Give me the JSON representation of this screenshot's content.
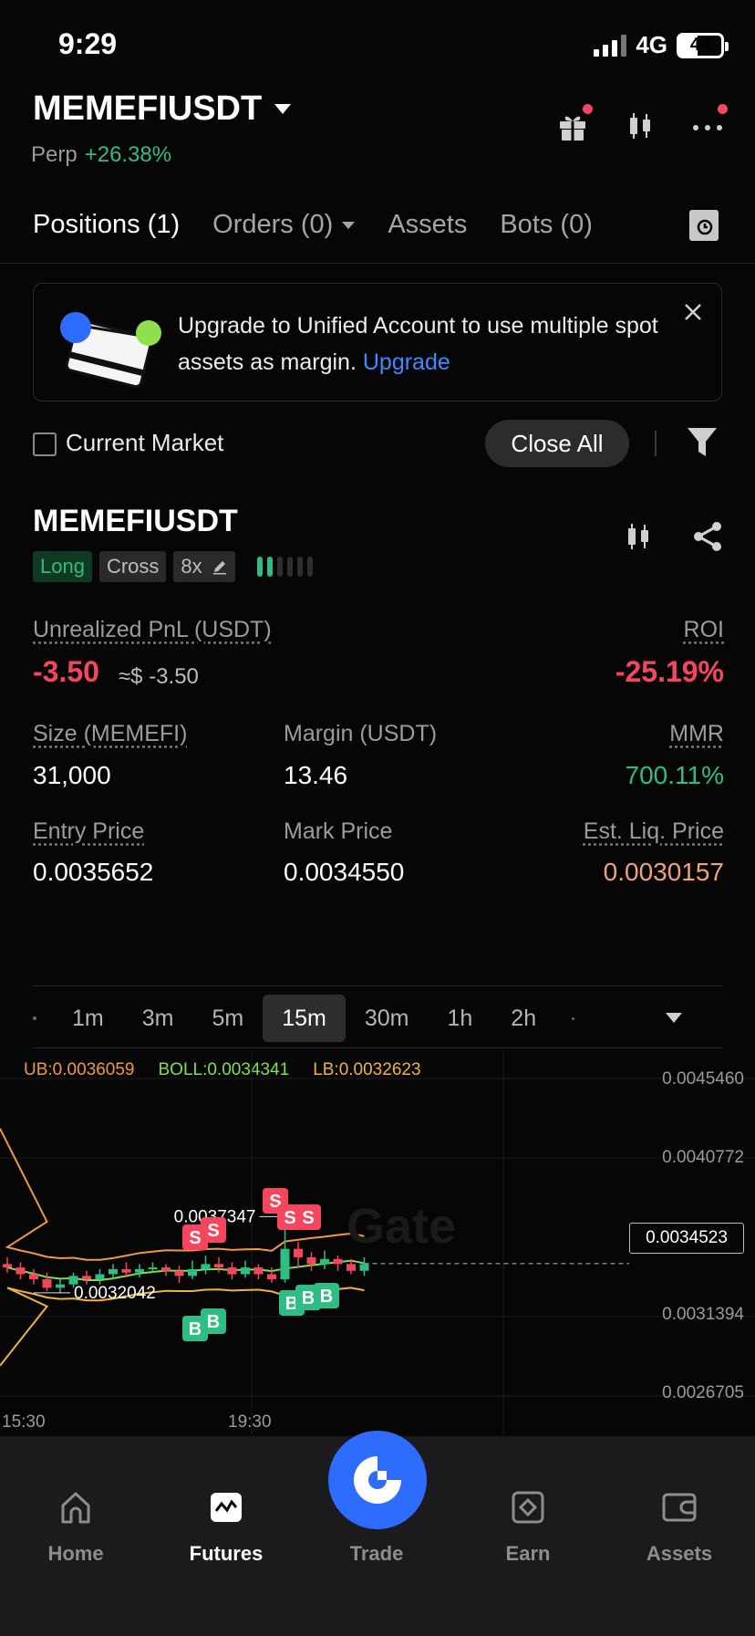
{
  "status_bar": {
    "time": "9:29",
    "network": "4G",
    "battery": "44"
  },
  "header": {
    "pair": "MEMEFIUSDT",
    "type": "Perp",
    "change": "+26.38%"
  },
  "tabs": [
    {
      "label": "Positions (1)",
      "active": true
    },
    {
      "label": "Orders (0)",
      "active": false
    },
    {
      "label": "Assets",
      "active": false
    },
    {
      "label": "Bots (0)",
      "active": false
    }
  ],
  "banner": {
    "text": "Upgrade to Unified Account to use multiple spot assets as margin.",
    "link": "Upgrade"
  },
  "filters": {
    "current_market": "Current Market",
    "close_all": "Close All"
  },
  "position": {
    "symbol": "MEMEFIUSDT",
    "side": "Long",
    "margin_mode": "Cross",
    "leverage": "8x",
    "unrealized_pnl_label": "Unrealized PnL (USDT)",
    "unrealized_pnl": "-3.50",
    "unrealized_pnl_usd": "≈$ -3.50",
    "roi_label": "ROI",
    "roi": "-25.19%",
    "size_label": "Size (MEMEFI)",
    "size": "31,000",
    "margin_label": "Margin (USDT)",
    "margin": "13.46",
    "mmr_label": "MMR",
    "mmr": "700.11%",
    "entry_label": "Entry Price",
    "entry": "0.0035652",
    "mark_label": "Mark Price",
    "mark": "0.0034550",
    "liq_label": "Est. Liq. Price",
    "liq": "0.0030157"
  },
  "timeframes": [
    "1m",
    "3m",
    "5m",
    "15m",
    "30m",
    "1h",
    "2h"
  ],
  "active_timeframe": "15m",
  "chart_data": {
    "type": "candlestick",
    "indicators": {
      "ub": "UB:0.0036059",
      "boll": "BOLL:0.0034341",
      "lb": "LB:0.0032623"
    },
    "y_ticks": [
      "0.0045460",
      "0.0040772",
      "0.0031394",
      "0.0026705"
    ],
    "current_price": "0.0034523",
    "high_label": "0.0037347",
    "low_label": "0.0032042",
    "x_ticks": [
      "15:30",
      "19:30"
    ],
    "watermark": "Gate",
    "ylim": [
      0.0026705,
      0.004546
    ],
    "candles": [
      [
        0.00345,
        0.00343,
        0.00349,
        0.0034
      ],
      [
        0.00343,
        0.00339,
        0.00346,
        0.00336
      ],
      [
        0.00339,
        0.00336,
        0.00342,
        0.00333
      ],
      [
        0.00336,
        0.00331,
        0.0034,
        0.00329
      ],
      [
        0.00331,
        0.00333,
        0.00336,
        0.00328
      ],
      [
        0.00333,
        0.00338,
        0.0034,
        0.00331
      ],
      [
        0.00338,
        0.00336,
        0.00341,
        0.00333
      ],
      [
        0.00336,
        0.00339,
        0.00342,
        0.00333
      ],
      [
        0.00339,
        0.00342,
        0.00345,
        0.00336
      ],
      [
        0.00342,
        0.0034,
        0.00346,
        0.00337
      ],
      [
        0.0034,
        0.00342,
        0.00345,
        0.00337
      ],
      [
        0.00342,
        0.00343,
        0.00346,
        0.0034
      ],
      [
        0.00343,
        0.00341,
        0.00345,
        0.00338
      ],
      [
        0.00341,
        0.00338,
        0.00344,
        0.00334
      ],
      [
        0.00338,
        0.00342,
        0.00347,
        0.00336
      ],
      [
        0.00342,
        0.00345,
        0.0035,
        0.00339
      ],
      [
        0.00345,
        0.00343,
        0.00349,
        0.0034
      ],
      [
        0.00343,
        0.00339,
        0.00346,
        0.00336
      ],
      [
        0.00339,
        0.00343,
        0.00347,
        0.00337
      ],
      [
        0.00343,
        0.00339,
        0.00345,
        0.00336
      ],
      [
        0.00339,
        0.00336,
        0.00343,
        0.00334
      ],
      [
        0.00336,
        0.00354,
        0.00373,
        0.00334
      ],
      [
        0.00354,
        0.00349,
        0.00358,
        0.00343
      ],
      [
        0.00349,
        0.00345,
        0.00352,
        0.00341
      ],
      [
        0.00345,
        0.00348,
        0.00353,
        0.00342
      ],
      [
        0.00348,
        0.00345,
        0.0035,
        0.00341
      ],
      [
        0.00345,
        0.00341,
        0.00348,
        0.00339
      ],
      [
        0.00341,
        0.00345,
        0.00349,
        0.00338
      ]
    ],
    "markers_sell": 5,
    "markers_buy": 5
  },
  "bottom_nav": [
    {
      "label": "Home",
      "icon": "home-icon",
      "active": false
    },
    {
      "label": "Futures",
      "icon": "futures-icon",
      "active": true
    },
    {
      "label": "Trade",
      "icon": "trade-icon",
      "active": false
    },
    {
      "label": "Earn",
      "icon": "earn-icon",
      "active": false
    },
    {
      "label": "Assets",
      "icon": "assets-icon",
      "active": false
    }
  ],
  "colors": {
    "up": "#2ebd85",
    "down": "#f6465d",
    "accent": "#2d6cff",
    "liq": "#f0a37a"
  }
}
